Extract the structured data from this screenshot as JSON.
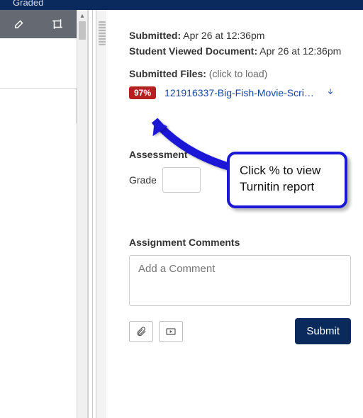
{
  "topbar": {
    "status": "Graded"
  },
  "meta": {
    "submitted_label": "Submitted:",
    "submitted_value": " Apr 26 at 12:36pm",
    "viewed_label": "Student Viewed Document:",
    "viewed_value": " Apr 26 at 12:36pm",
    "files_label": "Submitted Files:",
    "files_hint": " (click to load)"
  },
  "file": {
    "similarity_pct": "97%",
    "name": "121916337-Big-Fish-Movie-Script.…"
  },
  "assessment": {
    "title": "Assessment",
    "grade_label": "Grade",
    "grade_value": ""
  },
  "comments": {
    "title": "Assignment Comments",
    "placeholder": "Add a Comment",
    "submit_label": "Submit"
  },
  "callout": {
    "text": "Click % to view Turnitin report"
  }
}
